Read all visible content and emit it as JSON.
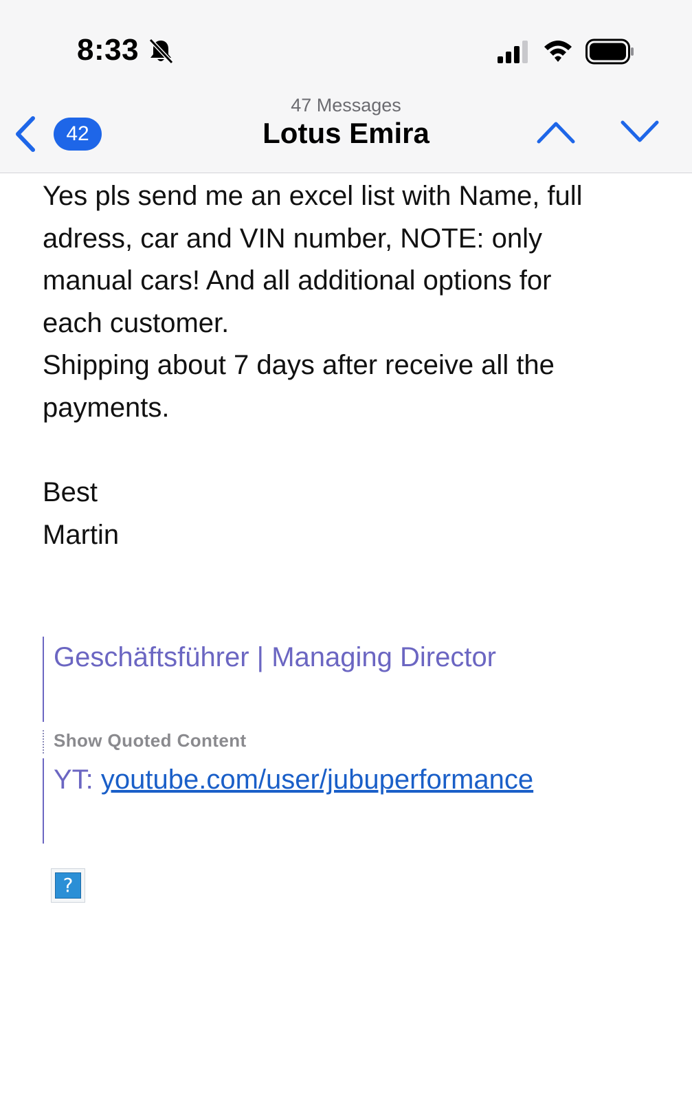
{
  "status_bar": {
    "time": "8:33",
    "icons": [
      "bell-slash-icon",
      "cellular-signal-icon",
      "wifi-icon",
      "battery-icon"
    ]
  },
  "nav": {
    "back_icon": "chevron-left-icon",
    "unread_count": "42",
    "message_count": "47 Messages",
    "title": "Lotus Emira",
    "prev_icon": "chevron-up-icon",
    "next_icon": "chevron-down-icon",
    "accent_color": "#1e66e8"
  },
  "message": {
    "lines": [
      "Yes pls send me an excel list with Name, full",
      "adress, car and VIN number, NOTE: only",
      "manual cars! And all additional options for",
      "each customer.",
      "Shipping about 7 days after receive all the",
      "payments."
    ],
    "closing": "Best",
    "sender": "Martin"
  },
  "signature": {
    "role": "Geschäftsführer | Managing Director",
    "show_quoted_label": "Show Quoted Content",
    "yt_prefix": "YT: ",
    "yt_link": "youtube.com/user/jubuperformance",
    "quote_color": "#6b66c2",
    "link_color": "#1a5fc8"
  },
  "attachment": {
    "placeholder_glyph": "?",
    "icon": "broken-image-icon"
  }
}
